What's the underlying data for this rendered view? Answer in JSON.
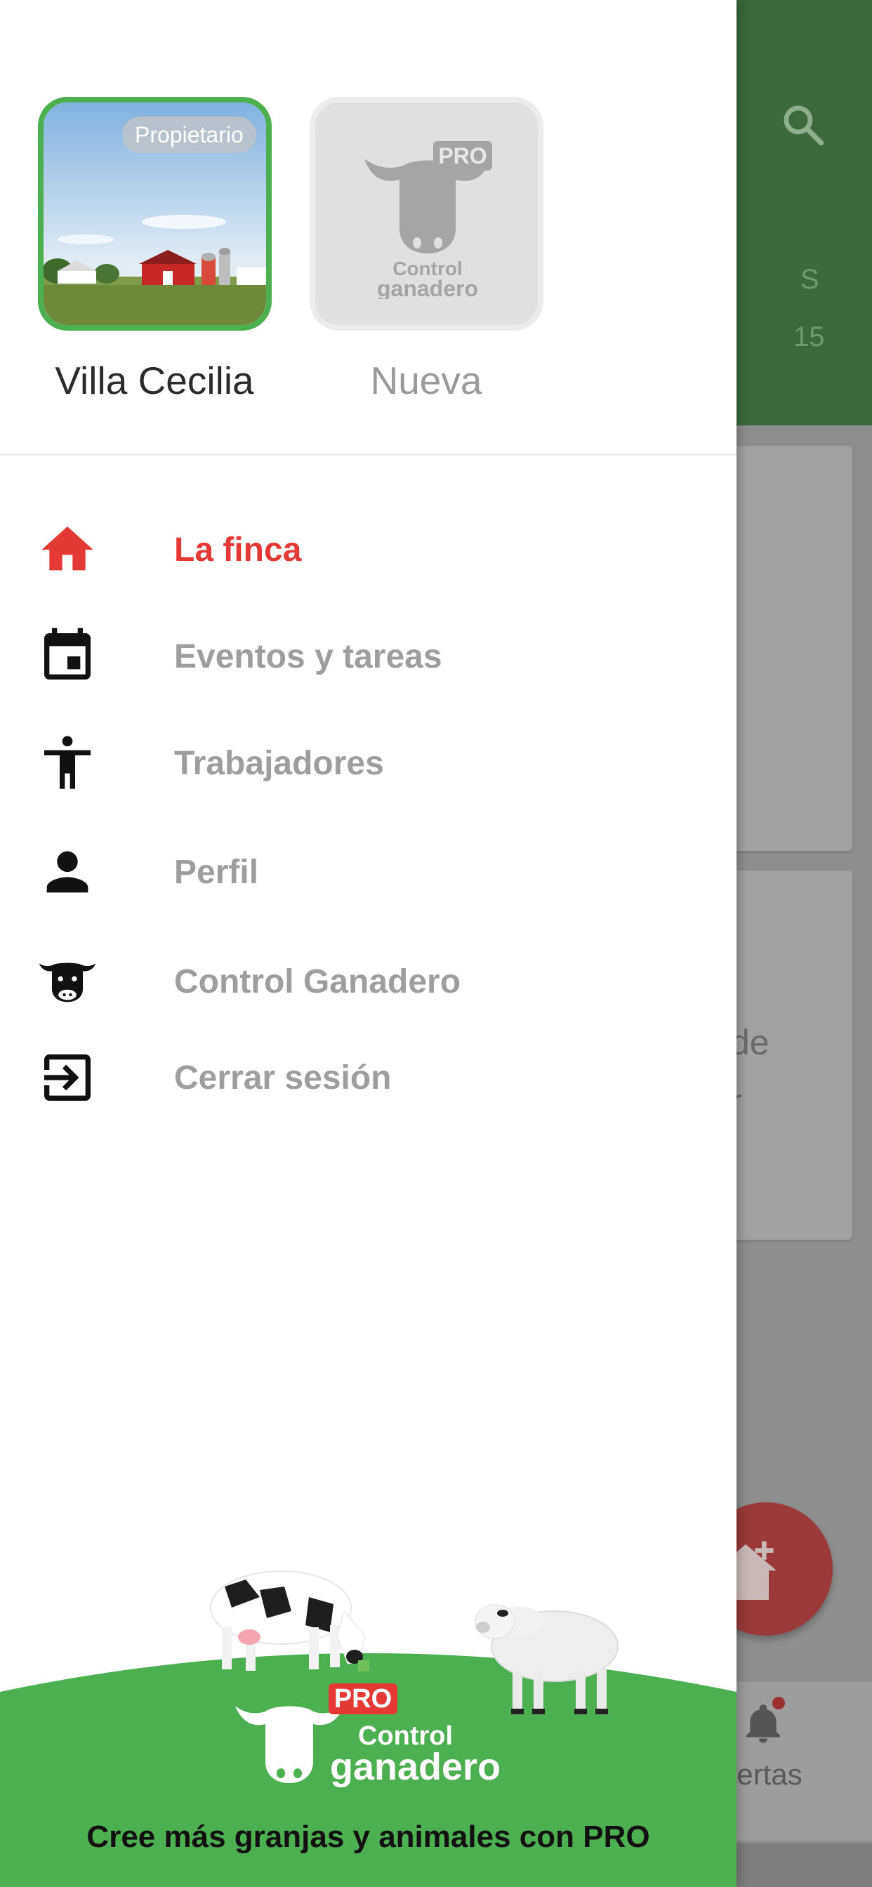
{
  "background": {
    "tab_letter": "S",
    "tab_number": "15",
    "card_text_1": "de",
    "card_text_2": "r",
    "alerts_label": "lertas"
  },
  "farms": [
    {
      "name": "Villa Cecilia",
      "badge": "Propietario"
    },
    {
      "name": "Nueva",
      "badge": "PRO",
      "logo_line_1": "Control",
      "logo_line_2": "ganadero"
    }
  ],
  "menu": [
    {
      "label": "La finca",
      "icon": "home-icon",
      "active": true
    },
    {
      "label": "Eventos y tareas",
      "icon": "calendar-icon"
    },
    {
      "label": "Trabajadores",
      "icon": "worker-icon"
    },
    {
      "label": "Perfil",
      "icon": "person-icon"
    },
    {
      "label": "Control Ganadero",
      "icon": "cow-icon"
    },
    {
      "label": "Cerrar sesión",
      "icon": "logout-icon"
    }
  ],
  "promo": {
    "badge": "PRO",
    "brand_line_1": "Control",
    "brand_line_2": "ganadero",
    "cta": "Cree más granjas y animales con PRO"
  },
  "colors": {
    "primary_green": "#4caf50",
    "header_green": "#3a6a3d",
    "active_red": "#e53935",
    "inactive_text": "#9e9e9e"
  }
}
